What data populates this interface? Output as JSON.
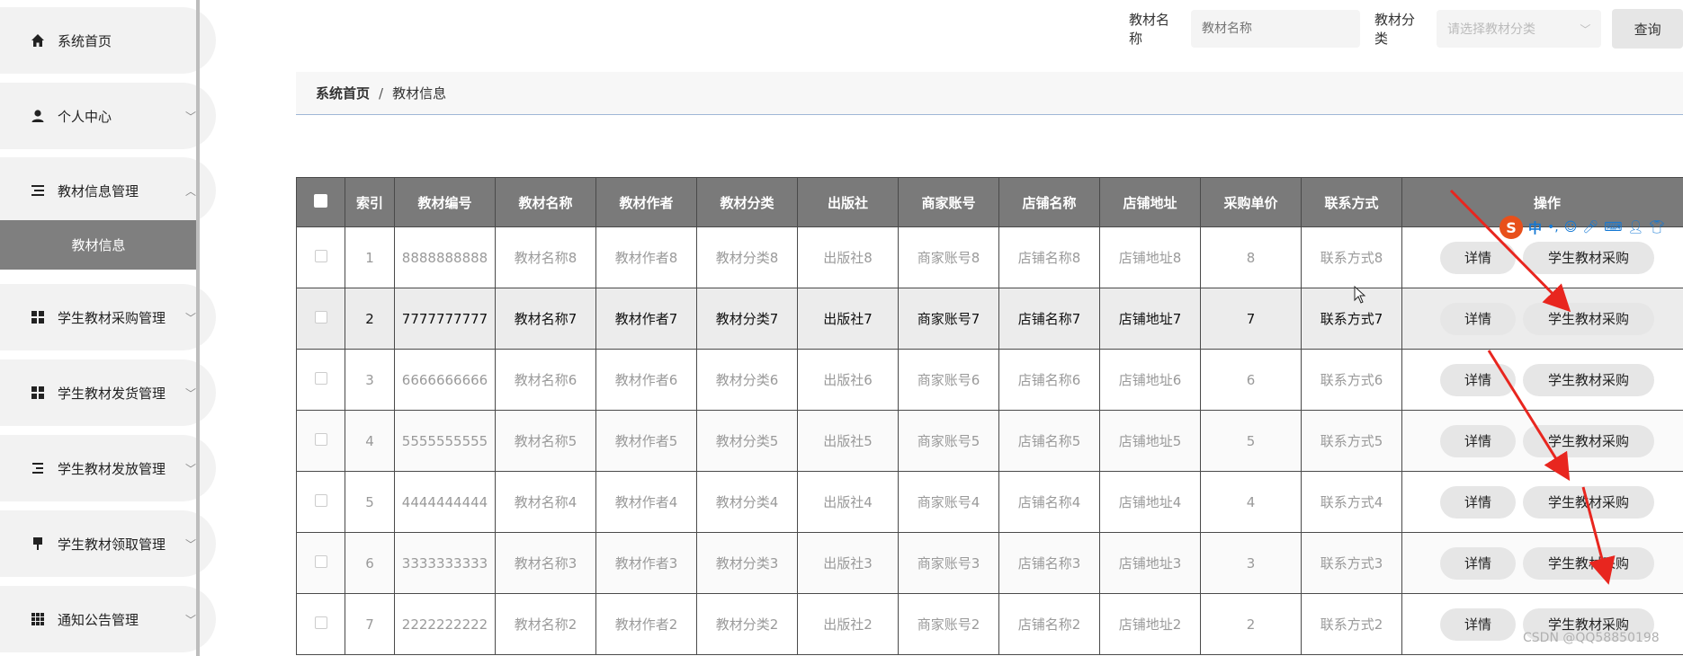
{
  "sidebar": {
    "items": [
      {
        "label": "系统首页",
        "icon": "home-icon",
        "has_chevron": false
      },
      {
        "label": "个人中心",
        "icon": "user-icon",
        "has_chevron": true
      },
      {
        "label": "教材信息管理",
        "icon": "list-icon",
        "has_chevron": true,
        "expanded": true
      },
      {
        "label": "学生教材采购管理",
        "icon": "grid-icon",
        "has_chevron": true
      },
      {
        "label": "学生教材发货管理",
        "icon": "grid-icon",
        "has_chevron": true
      },
      {
        "label": "学生教材发放管理",
        "icon": "align-icon",
        "has_chevron": true
      },
      {
        "label": "学生教材领取管理",
        "icon": "pin-icon",
        "has_chevron": true
      },
      {
        "label": "通知公告管理",
        "icon": "apps-icon",
        "has_chevron": true
      }
    ],
    "active_sub": "教材信息"
  },
  "search": {
    "name_label": "教材名称",
    "name_placeholder": "教材名称",
    "category_label": "教材分类",
    "category_placeholder": "请选择教材分类",
    "query_button": "查询"
  },
  "breadcrumb": {
    "home": "系统首页",
    "separator": "/",
    "current": "教材信息"
  },
  "table": {
    "headers": [
      "索引",
      "教材编号",
      "教材名称",
      "教材作者",
      "教材分类",
      "出版社",
      "商家账号",
      "店铺名称",
      "店铺地址",
      "采购单价",
      "联系方式",
      "操作"
    ],
    "rows": [
      [
        "1",
        "8888888888",
        "教材名称8",
        "教材作者8",
        "教材分类8",
        "出版社8",
        "商家账号8",
        "店铺名称8",
        "店铺地址8",
        "8",
        "联系方式8"
      ],
      [
        "2",
        "7777777777",
        "教材名称7",
        "教材作者7",
        "教材分类7",
        "出版社7",
        "商家账号7",
        "店铺名称7",
        "店铺地址7",
        "7",
        "联系方式7"
      ],
      [
        "3",
        "6666666666",
        "教材名称6",
        "教材作者6",
        "教材分类6",
        "出版社6",
        "商家账号6",
        "店铺名称6",
        "店铺地址6",
        "6",
        "联系方式6"
      ],
      [
        "4",
        "5555555555",
        "教材名称5",
        "教材作者5",
        "教材分类5",
        "出版社5",
        "商家账号5",
        "店铺名称5",
        "店铺地址5",
        "5",
        "联系方式5"
      ],
      [
        "5",
        "4444444444",
        "教材名称4",
        "教材作者4",
        "教材分类4",
        "出版社4",
        "商家账号4",
        "店铺名称4",
        "店铺地址4",
        "4",
        "联系方式4"
      ],
      [
        "6",
        "3333333333",
        "教材名称3",
        "教材作者3",
        "教材分类3",
        "出版社3",
        "商家账号3",
        "店铺名称3",
        "店铺地址3",
        "3",
        "联系方式3"
      ],
      [
        "7",
        "2222222222",
        "教材名称2",
        "教材作者2",
        "教材分类2",
        "出版社2",
        "商家账号2",
        "店铺名称2",
        "店铺地址2",
        "2",
        "联系方式2"
      ]
    ],
    "active_row_index": 1,
    "detail_button": "详情",
    "purchase_button": "学生教材采购"
  },
  "ime": {
    "logo": "S",
    "mode": "中",
    "punct": "•,"
  },
  "watermark": "CSDN @QQ58850198",
  "colors": {
    "header_bg": "#7a7a7a",
    "submenu_active": "#7f7f7f",
    "arrow": "#e8261f"
  }
}
